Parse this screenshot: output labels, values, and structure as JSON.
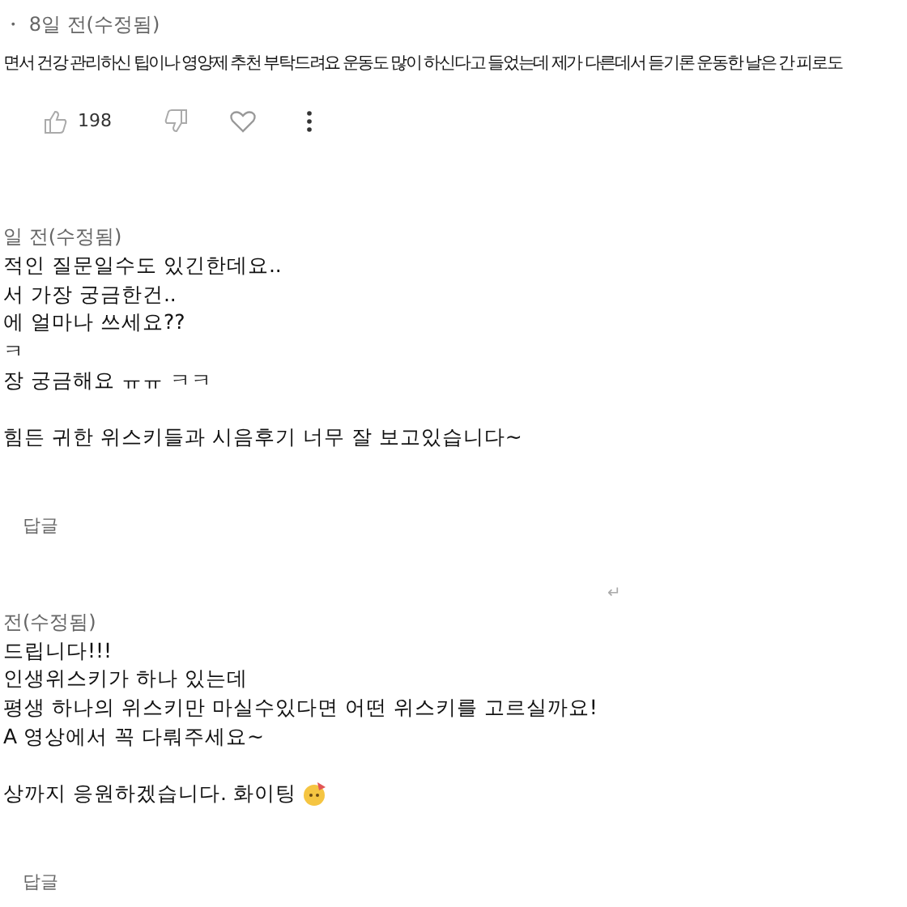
{
  "comments": [
    {
      "meta": "・ 8일 전(수정됨)",
      "paragraphs": [
        [
          "면서 건강 관리하신 팁이나 영양제 추천 부탁드려요 운동도 많이 하신다고 들었는데 제가 다른데서 듣기론 운동한 날은 간 피로도"
        ]
      ],
      "likes": "198"
    },
    {
      "meta": "일 전(수정됨)",
      "paragraphs": [
        [
          "적인 질문일수도 있긴한데요..",
          "서 가장 궁금한건..",
          "에 얼마나 쓰세요??",
          "ㅋ",
          "장 궁금해요 ㅠㅠ ㅋㅋ"
        ],
        [
          "힘든 귀한 위스키들과 시음후기 너무 잘 보고있습니다~"
        ]
      ],
      "reply": "답글",
      "trailing_mark": "↵"
    },
    {
      "meta": "전(수정됨)",
      "paragraphs": [
        [
          "드립니다!!!",
          "인생위스키가 하나 있는데",
          "평생 하나의 위스키만 마실수있다면 어떤 위스키를 고르실까요!",
          "A 영상에서 꼭 다뤄주세요~"
        ],
        [
          "상까지 응원하겠습니다. 화이팅"
        ]
      ],
      "reply": "답글"
    }
  ]
}
